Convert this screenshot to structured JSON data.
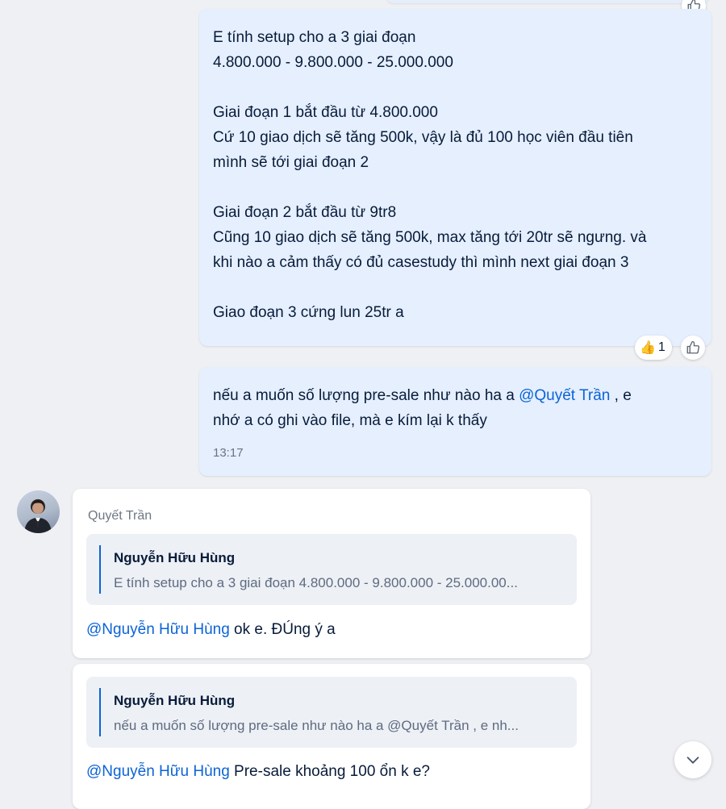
{
  "messages": {
    "m1": {
      "paragraphs": [
        [
          "E tính setup cho a 3 giai đoạn",
          "4.800.000 - 9.800.000 - 25.000.000"
        ],
        [
          "Giai đoạn 1 bắt đầu từ 4.800.000",
          "Cứ 10 giao dịch sẽ tăng 500k, vậy là đủ 100 học viên đầu tiên",
          "mình sẽ tới giai đoạn 2"
        ],
        [
          "Giai đoạn 2 bắt đầu từ 9tr8",
          "Cũng 10 giao dịch sẽ tăng 500k, max tăng tới 20tr sẽ ngưng. và",
          "khi nào a cảm thấy có đủ casestudy thì mình next giai đoạn 3"
        ],
        [
          "Giao đoạn 3 cứng lun 25tr a"
        ]
      ],
      "reaction": {
        "icon": "thumbs-up-emoji",
        "emoji": "👍",
        "count": "1"
      }
    },
    "m2": {
      "line1_pre": "nếu a muốn số lượng pre-sale như nào ha a ",
      "line1_mention": "@Quyết Trần",
      "line1_post": " , e",
      "line2": "nhớ a có ghi vào file, mà e kím lại k thấy",
      "time": "13:17"
    },
    "m3": {
      "sender": "Quyết Trần",
      "quote_author": "Nguyễn Hữu Hùng",
      "quote_text": "E tính setup cho a 3 giai đoạn 4.800.000 - 9.800.000 - 25.000.00...",
      "mention": "@Nguyễn Hữu Hùng",
      "text": " ok e. ĐÚng ý a"
    },
    "m4": {
      "quote_author": "Nguyễn Hữu Hùng",
      "quote_text": "nếu a muốn số lượng pre-sale như nào ha a @Quyết Trần , e nh...",
      "mention": "@Nguyễn Hữu Hùng",
      "text": " Pre-sale khoảng 100 ổn k e?"
    }
  },
  "colors": {
    "accent": "#0b63d6",
    "outgoing_bubble": "#e5effe",
    "incoming_bubble": "#ffffff",
    "background": "#eef0f3"
  },
  "icons": {
    "like": "thumbs-up-outline-icon",
    "scroll": "chevron-down-icon"
  }
}
